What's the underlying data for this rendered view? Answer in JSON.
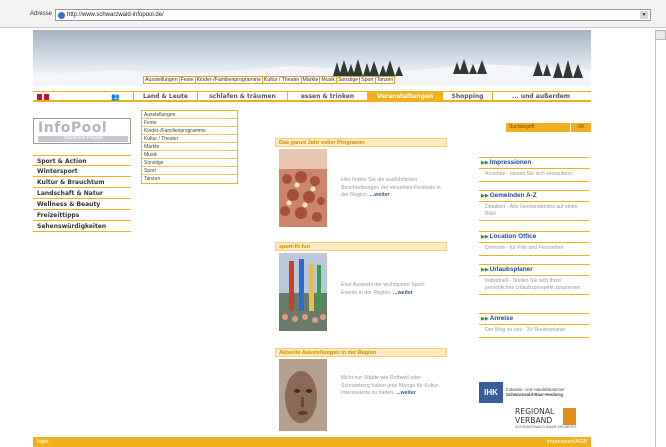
{
  "browser": {
    "address_label": "Adresse",
    "url": "http://www.schwarzwald-infopool.de/"
  },
  "subnav": [
    "Ausstellungen",
    "Feste",
    "Kinder-/Familienprogramme",
    "Kultur / Theater",
    "Märkte",
    "Musik",
    "Sonstige",
    "Sport",
    "Tanzen"
  ],
  "mainnav": [
    {
      "label": "Land & Leute",
      "active": false,
      "width": 64
    },
    {
      "label": "schlafen & träumen",
      "active": false,
      "width": 90
    },
    {
      "label": "essen & trinken",
      "active": false,
      "width": 80
    },
    {
      "label": "Veranstaltungen",
      "active": true,
      "width": 75
    },
    {
      "label": "Shopping",
      "active": false,
      "width": 50
    },
    {
      "label": "... und außerdem",
      "active": false,
      "width": 98
    }
  ],
  "dropdown": [
    "Ausstellungen",
    "Feste",
    "Kinder-/Familienprogramme",
    "Kultur / Theater",
    "Märkte",
    "Musik",
    "Sonstige",
    "Sport",
    "Tanzen"
  ],
  "logo": {
    "title": "InfoPool",
    "subtitle": "Tourismus-Freizeit"
  },
  "leftnav": [
    "Sport & Action",
    "Wintersport",
    "Kultur & Brauchtum",
    "Landschaft & Natur",
    "Wellness & Beauty",
    "Freizeittipps",
    "Sehenswürdigkeiten"
  ],
  "sections": [
    {
      "title": "Das ganze Jahr voller Programm",
      "text": "Hier finden Sie die ausführlichen Beschreibungen der einzelnen Festivals in der Region.",
      "more": "...weiter"
    },
    {
      "title": "sport-fit-fun",
      "text": "Eine Auswahl der wichtigsten Sport-Events in der Region.",
      "more": "...weiter"
    },
    {
      "title": "Aktuelle Ausstellungen in der Region",
      "text": "Nicht nur Städte wie Rottweil oder Schramberg haben jede Menge für Kultur-Interessierte zu bieten.",
      "more": "...weiter"
    }
  ],
  "search": {
    "value": "Suchbegriff",
    "button": "OK"
  },
  "rightboxes": [
    {
      "title": "Impressionen",
      "desc": "Ansehen - lassen Sie sich verzaubern"
    },
    {
      "title": "Gemeinden A-Z",
      "desc": "Detailiert - Alle Gemeindeinfos auf einen Blick"
    },
    {
      "title": "Location Office",
      "desc": "Drehorte - für Film und Fernsehen"
    },
    {
      "title": "Urlaubsplaner",
      "desc": "Individuell - Stellen Sie sich Ihren persönlichen Urlaubsprospekt zusammen"
    },
    {
      "title": "Anreise",
      "desc": "Der Weg zu uns - 3V Routenplaner"
    }
  ],
  "ihk": {
    "logo": "IHK",
    "line1": "Industrie- und Handelskammer",
    "line2": "Schwarzwald-Baar-Heuberg"
  },
  "regional": {
    "line1": "REGIONAL",
    "line2": "VERBAND",
    "sub": "SCHWARZWALD-BAAR-HEUBERG"
  },
  "footer": {
    "left": "login",
    "right": "Impressum/AGB"
  },
  "colors": {
    "accent": "#f0b020",
    "link": "#234a8a",
    "header_text": "#d68a00"
  }
}
